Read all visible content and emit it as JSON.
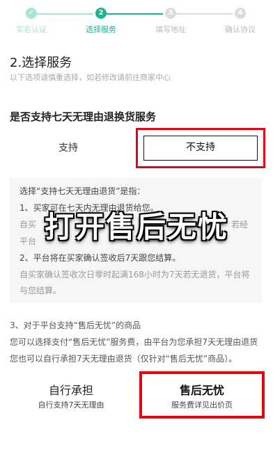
{
  "stepper": {
    "steps": [
      {
        "label": "实名认证",
        "badge": "✓",
        "state": "done"
      },
      {
        "label": "选择服务",
        "badge": "2",
        "state": "active"
      },
      {
        "label": "填写地址",
        "badge": "3",
        "state": "todo"
      },
      {
        "label": "确认协议",
        "badge": "4",
        "state": "todo"
      }
    ]
  },
  "section": {
    "title": "2.选择服务",
    "subtitle": "以下选项请慎重选择，如若修改请前往商家中心"
  },
  "question": {
    "title": "是否支持七天无理由退换货服务",
    "option_yes": "支持",
    "option_no": "不支持"
  },
  "info": {
    "line1": "选择“支持七天无理由退货”是指：",
    "line2": "1、买家可在七天内无理由退货给您。",
    "line3": "自买",
    "line3_end": "若经",
    "line4": "平台",
    "line5": "2、平台将在买家确认签收后7天跟您结算。",
    "line6": "自买家确认签收次日零时起满168小时为7天若无退货，平台将",
    "line7": "与您结算。"
  },
  "overlay": {
    "text": "打开售后无忧"
  },
  "point3": {
    "line1": "3、对于平台支持“售后无忧”的商品",
    "line2": "您可以选择支付“售后无忧”服务费，由平台为您承担7天无理由退货",
    "line3": "您也可以自行承担7天无理由退货（仅针对“售后无忧”商品）。"
  },
  "bottom": {
    "self_title": "自行承担",
    "self_sub": "自行支持7天无理由",
    "after_title": "售后无忧",
    "after_sub": "服务费详见出价页"
  },
  "colors": {
    "accent": "#1ab394",
    "highlight": "#e30613"
  }
}
